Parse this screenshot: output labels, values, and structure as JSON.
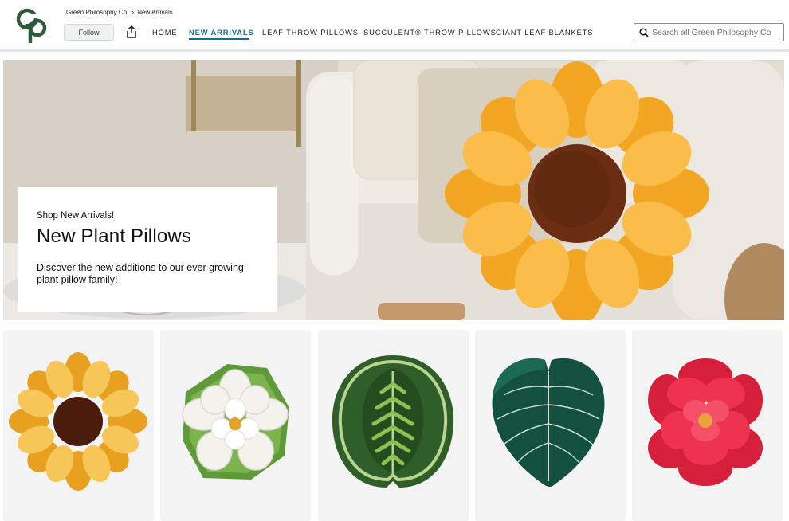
{
  "store": {
    "logo_icon": "green-philosophy-logo-icon",
    "breadcrumb": [
      "Green Philosophy Co.",
      "New Arrivals"
    ],
    "follow_label": "Follow",
    "share_icon": "share-icon"
  },
  "nav": {
    "items": [
      "HOME",
      "NEW ARRIVALS",
      "LEAF THROW PILLOWS",
      "SUCCULENT® THROW PILLOWS",
      "GIANT LEAF BLANKETS"
    ],
    "active": "NEW ARRIVALS",
    "accent_color": "#146e8c"
  },
  "search": {
    "placeholder": "Search all Green Philosophy Co",
    "icon": "search-icon"
  },
  "hero": {
    "kicker": "Shop New Arrivals!",
    "title": "New Plant Pillows",
    "description": "Discover the new additions to our ever growing plant pillow family!",
    "image": "sunflower-pillow-on-sofa-image"
  },
  "products": [
    {
      "image": "sunflower-pillow-image"
    },
    {
      "image": "white-lotus-pillow-image"
    },
    {
      "image": "fern-leaf-pillow-image"
    },
    {
      "image": "velvet-monstera-leaf-pillow-image"
    },
    {
      "image": "red-rose-pillow-image"
    }
  ]
}
